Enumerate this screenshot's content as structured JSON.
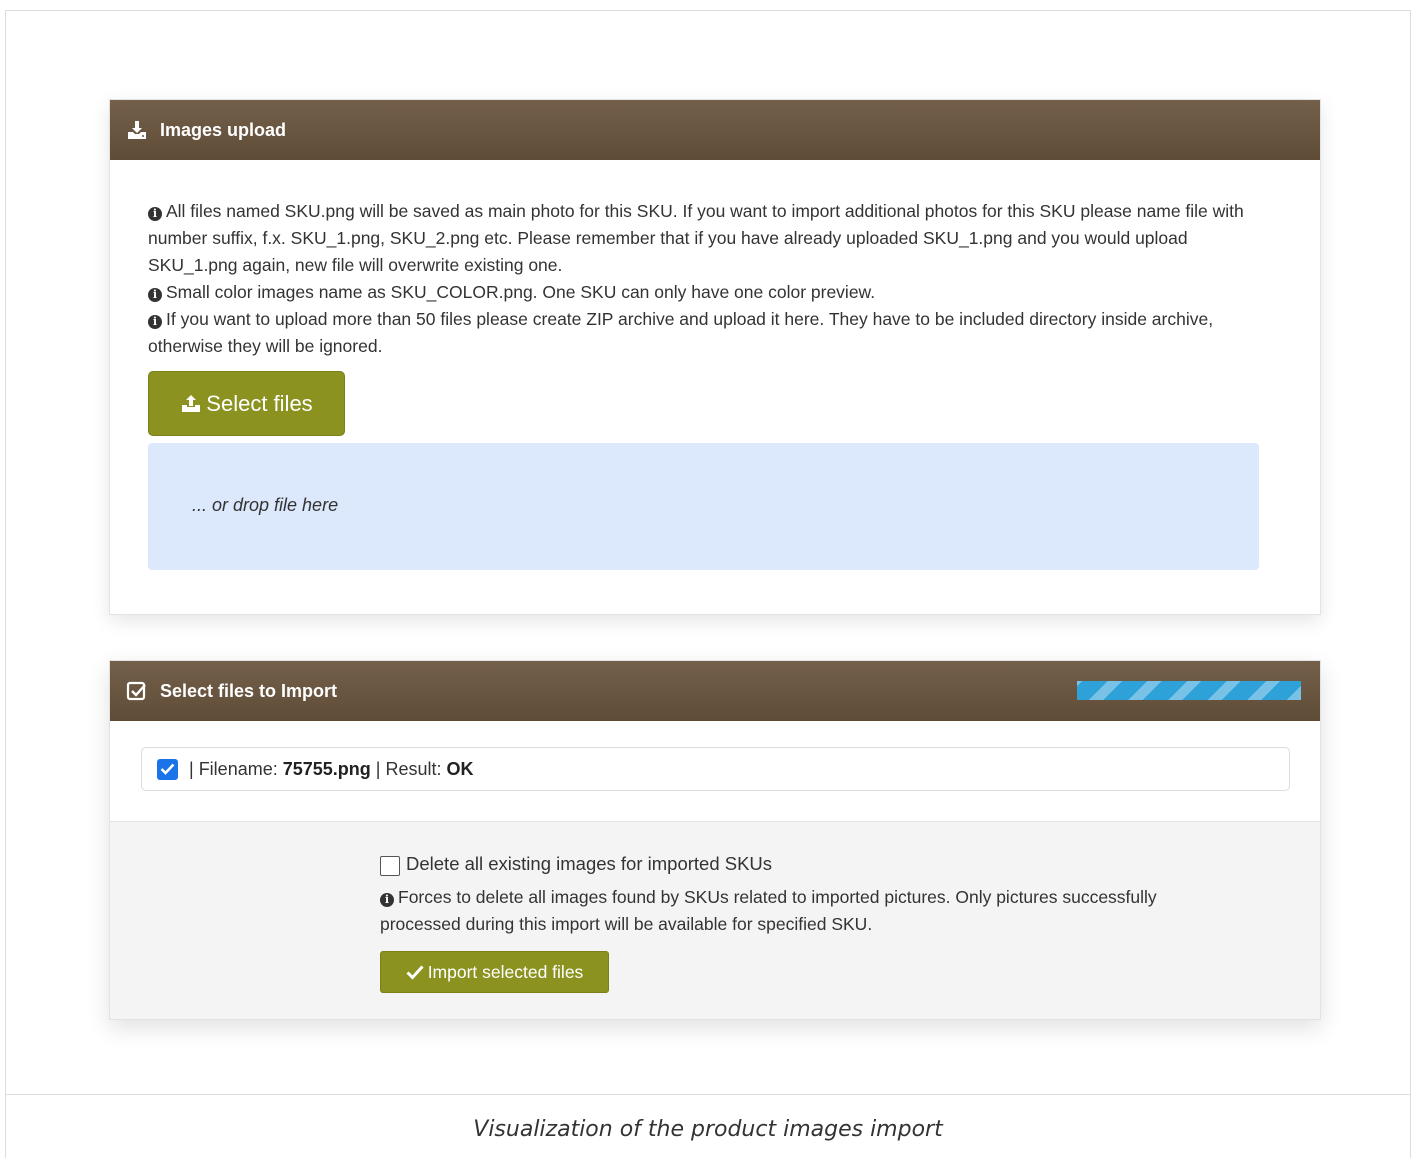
{
  "caption": "Visualization of the product images import",
  "upload_panel": {
    "title": "Images upload",
    "icon": "download-icon",
    "info_lines": [
      "All files named SKU.png will be saved as main photo for this SKU. If you want to import additional photos for this SKU please name file with number suffix, f.x. SKU_1.png, SKU_2.png etc. Please remember that if you have already uploaded SKU_1.png and you would upload SKU_1.png again, new file will overwrite existing one.",
      "Small color images name as SKU_COLOR.png. One SKU can only have one color preview.",
      "If you want to upload more than 50 files please create ZIP archive and upload it here. They have to be included directory inside archive, otherwise they will be ignored."
    ],
    "select_button_label": "Select files",
    "drop_text": "... or drop file here",
    "button_color": "#8b9220",
    "header_color": "#6a5640",
    "dropzone_color": "#dce8fb"
  },
  "import_panel": {
    "title": "Select files to Import",
    "icon": "check-square-icon",
    "progress_fraction": 1.0,
    "progress_color": "#2ea2d8",
    "files": [
      {
        "checked": true,
        "filename_label": "Filename:",
        "filename": "75755.png",
        "result_label": "Result:",
        "result": "OK"
      }
    ],
    "delete_option": {
      "checked": false,
      "label": "Delete all existing images for imported SKUs",
      "info": "Forces to delete all images found by SKUs related to imported pictures. Only pictures successfully processed during this import will be available for specified SKU."
    },
    "import_button_label": "Import selected files"
  }
}
